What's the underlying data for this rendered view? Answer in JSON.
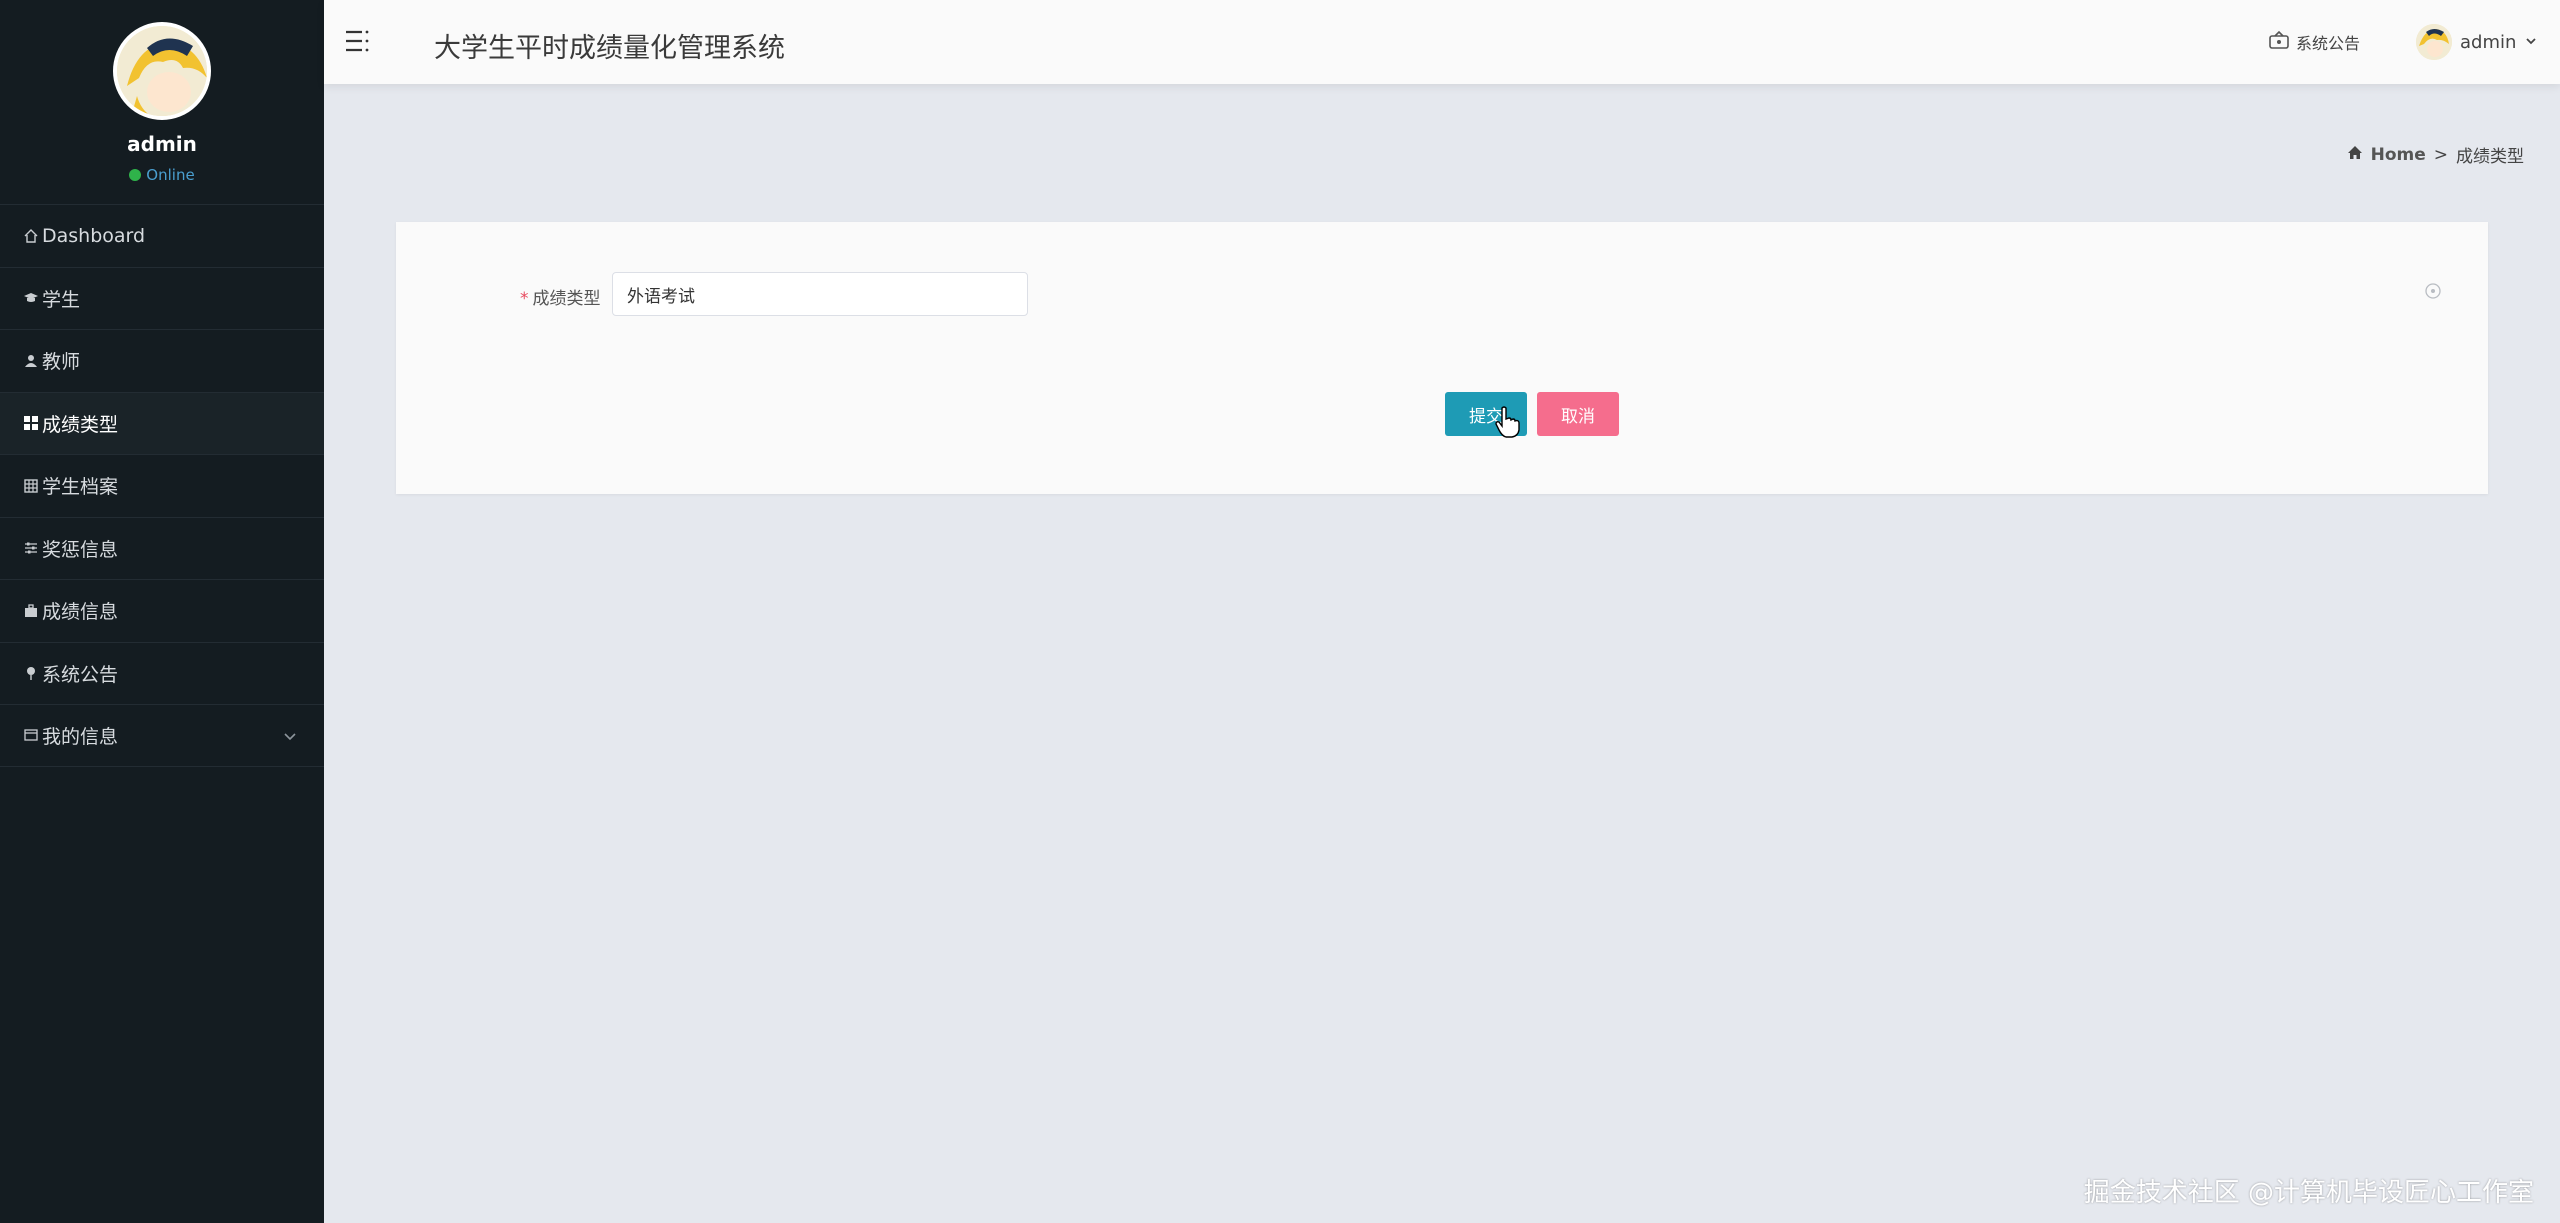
{
  "sidebar": {
    "user": {
      "name": "admin",
      "status": "Online"
    },
    "items": [
      {
        "label": "Dashboard",
        "icon": "home-icon"
      },
      {
        "label": "学生",
        "icon": "graduation-icon"
      },
      {
        "label": "教师",
        "icon": "user-icon"
      },
      {
        "label": "成绩类型",
        "icon": "grid-icon",
        "active": true
      },
      {
        "label": "学生档案",
        "icon": "table-icon"
      },
      {
        "label": "奖惩信息",
        "icon": "sliders-icon"
      },
      {
        "label": "成绩信息",
        "icon": "briefcase-icon"
      },
      {
        "label": "系统公告",
        "icon": "pin-icon"
      },
      {
        "label": "我的信息",
        "icon": "window-icon",
        "has_submenu": true
      }
    ]
  },
  "header": {
    "title": "大学生平时成绩量化管理系统",
    "notice_label": "系统公告",
    "user_label": "admin"
  },
  "breadcrumb": {
    "home": "Home",
    "separator": ">",
    "current": "成绩类型"
  },
  "form": {
    "field_label": "成绩类型",
    "required_mark": "*",
    "field_value": "外语考试",
    "submit_label": "提交",
    "cancel_label": "取消"
  },
  "watermark": "掘金技术社区 @计算机毕设匠心工作室",
  "colors": {
    "sidebar_bg": "#141c21",
    "content_bg": "#e5e8ee",
    "submit_button": "#1e9bb5",
    "cancel_button": "#f56d8d",
    "online_dot": "#2fb34a"
  }
}
